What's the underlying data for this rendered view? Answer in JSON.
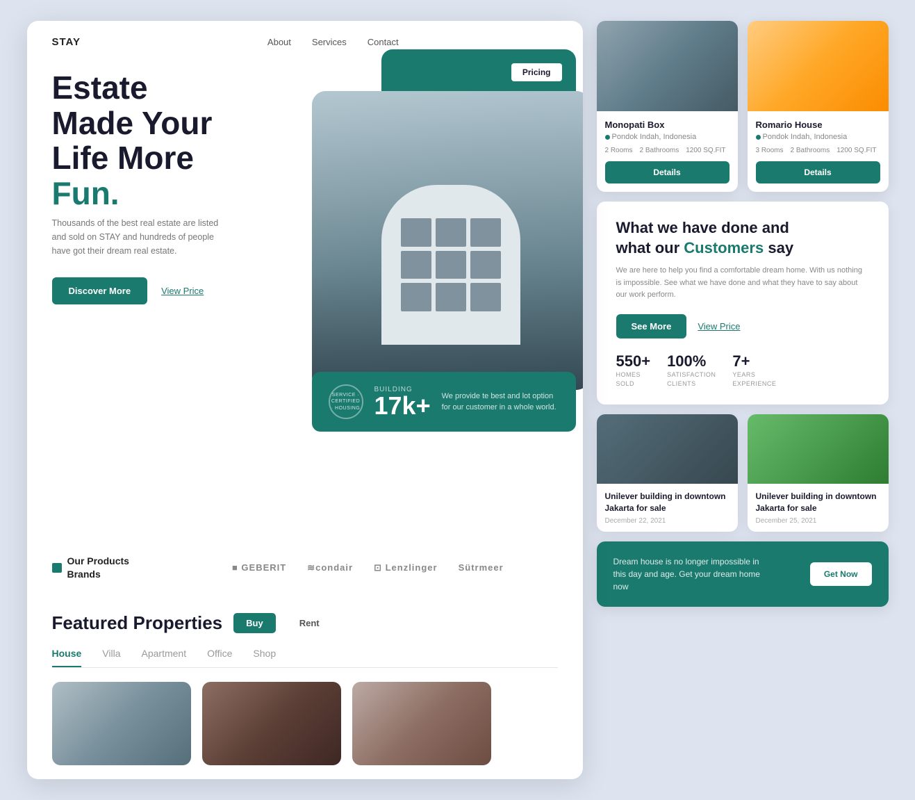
{
  "nav": {
    "logo": "STAY",
    "links": [
      "About",
      "Services",
      "Contact"
    ]
  },
  "hero": {
    "title_line1": "Estate",
    "title_line2": "Made Your",
    "title_line3": "Life More",
    "title_accent": "Fun.",
    "subtitle": "Thousands of the best real estate are listed and sold on STAY and hundreds of people have got their dream real estate.",
    "btn_discover": "Discover More",
    "btn_view": "View Price",
    "pricing_badge": "Pricing",
    "stats_label": "BUILDING",
    "stats_number": "17k+",
    "stats_badge_text": "SERVICE · CERTIFIED · HOUSING",
    "stats_desc": "We provide te best and lot option for our customer in a whole world."
  },
  "brands": {
    "section_label": "Our Products\nBrands",
    "logos": [
      "■ GEBERIT",
      "≋condair",
      "⊡ Lenzlinger",
      "Sütrmeer"
    ]
  },
  "featured": {
    "title": "Featured Properties",
    "tab_buy": "Buy",
    "tab_rent": "Rent",
    "categories": [
      "House",
      "Villa",
      "Apartment",
      "Office",
      "Shop"
    ],
    "active_category": "House"
  },
  "listings": {
    "top": [
      {
        "name": "Monopati Box",
        "location": "Pondok Indah, Indonesia",
        "rooms": "2 Rooms",
        "bathrooms": "2 Bathrooms",
        "size": "1200 SQ.FIT",
        "btn": "Details"
      },
      {
        "name": "Romario House",
        "location": "Pondok Indah, Indonesia",
        "rooms": "3 Rooms",
        "bathrooms": "2 Bathrooms",
        "size": "1200 SQ.FIT",
        "btn": "Details"
      }
    ]
  },
  "customers": {
    "title_line1": "What we have done and",
    "title_line2": "what our",
    "title_accent": "Customers",
    "title_line3": "say",
    "desc": "We are here to help you find a comfortable dream home. With us nothing is impossible. See what we have done and what they have to say about our work perform.",
    "btn_see_more": "See More",
    "btn_view_price": "View Price",
    "stats": [
      {
        "number": "550+",
        "label": "HOMES\nSOLD"
      },
      {
        "number": "100%",
        "label": "SATISFACTION\nCLIENTS"
      },
      {
        "number": "7+",
        "label": "YEARS\nEXPERIENCE"
      }
    ]
  },
  "news": [
    {
      "title": "Unilever building in downtown Jakarta for sale",
      "date": "December 22, 2021"
    },
    {
      "title": "Unilever building in downtown Jakarta for sale",
      "date": "December 25, 2021"
    }
  ],
  "cta": {
    "text": "Dream house is no longer impossible in this day and age. Get your dream home now",
    "btn": "Get Now"
  }
}
